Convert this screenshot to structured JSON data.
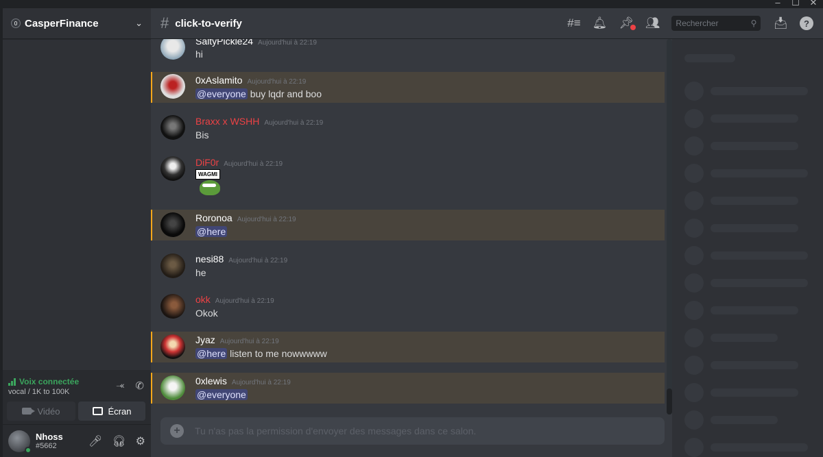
{
  "window": {
    "controls": [
      "–",
      "☐",
      "✕"
    ]
  },
  "server": {
    "name": "CasperFinance",
    "badge": "0"
  },
  "voice": {
    "status": "Voix connectée",
    "channel": "vocal / 1K to 100K",
    "video_label": "Vidéo",
    "screen_label": "Écran",
    "color": "#3ba55d"
  },
  "user": {
    "name": "Nhoss",
    "tag": "#5662"
  },
  "channel": {
    "name": "click-to-verify"
  },
  "search": {
    "placeholder": "Rechercher"
  },
  "composer": {
    "placeholder": "Tu n'as pas la permission d'envoyer des messages dans ce salon."
  },
  "messages": [
    {
      "author": "SaltyPickle24",
      "time": "Aujourd'hui à 22:19",
      "text": "hi",
      "mention": "",
      "author_color": "#ffffff",
      "highlight": false
    },
    {
      "author": "0xAslamito",
      "time": "Aujourd'hui à 22:19",
      "text": " buy lqdr and boo",
      "mention": "@everyone",
      "author_color": "#ffffff",
      "highlight": true
    },
    {
      "author": "Braxx x WSHH",
      "time": "Aujourd'hui à 22:19",
      "text": "Bis",
      "mention": "",
      "author_color": "#ed4245",
      "highlight": false
    },
    {
      "author": "DiF0r",
      "time": "Aujourd'hui à 22:19",
      "text": "",
      "mention": "",
      "author_color": "#ed4245",
      "highlight": false,
      "sticker": "WAGMI"
    },
    {
      "author": "Roronoa",
      "time": "Aujourd'hui à 22:19",
      "text": "",
      "mention": "@here",
      "author_color": "#ffffff",
      "highlight": true
    },
    {
      "author": "nesi88",
      "time": "Aujourd'hui à 22:19",
      "text": "he",
      "mention": "",
      "author_color": "#ffffff",
      "highlight": false
    },
    {
      "author": "okk",
      "time": "Aujourd'hui à 22:19",
      "text": "Okok",
      "mention": "",
      "author_color": "#ed4245",
      "highlight": false
    },
    {
      "author": "Jyaz",
      "time": "Aujourd'hui à 22:19",
      "text": " listen to me nowwwww",
      "mention": "@here",
      "author_color": "#ffffff",
      "highlight": true
    },
    {
      "author": "0xlewis",
      "time": "Aujourd'hui à 22:19",
      "text": "",
      "mention": "@everyone",
      "author_color": "#ffffff",
      "highlight": true
    }
  ],
  "colors": {
    "mention_bg": "#49443c",
    "mention_bar": "#faa81a",
    "pill_bg": "#414675",
    "accent_red": "#ed4245"
  },
  "icons": [
    "threads-icon",
    "bell-icon",
    "pin-icon",
    "members-icon",
    "inbox-icon",
    "help-icon",
    "mic-icon",
    "headphones-icon",
    "gear-icon",
    "noise-suppression-icon",
    "disconnect-icon"
  ]
}
